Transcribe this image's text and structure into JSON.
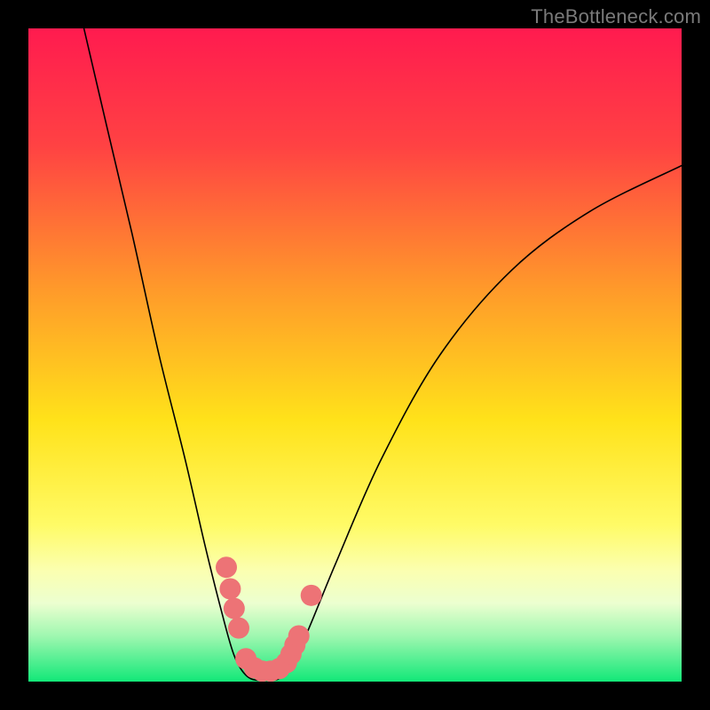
{
  "watermark": "TheBottleneck.com",
  "chart_data": {
    "type": "line",
    "title": "",
    "xlabel": "",
    "ylabel": "",
    "xlim": [
      0,
      100
    ],
    "ylim": [
      0,
      100
    ],
    "gradient_stops": [
      {
        "offset": 0,
        "color": "#ff1b4f"
      },
      {
        "offset": 18,
        "color": "#ff4243"
      },
      {
        "offset": 40,
        "color": "#ff9a2a"
      },
      {
        "offset": 60,
        "color": "#ffe21a"
      },
      {
        "offset": 76,
        "color": "#fffb66"
      },
      {
        "offset": 83,
        "color": "#fbffb0"
      },
      {
        "offset": 88,
        "color": "#ecffd0"
      },
      {
        "offset": 93,
        "color": "#9ff7b0"
      },
      {
        "offset": 100,
        "color": "#12e878"
      }
    ],
    "series": [
      {
        "name": "left-branch",
        "type": "curve",
        "points": [
          {
            "x": 8.5,
            "y": 100
          },
          {
            "x": 12,
            "y": 85
          },
          {
            "x": 16,
            "y": 68
          },
          {
            "x": 20,
            "y": 50
          },
          {
            "x": 24,
            "y": 34
          },
          {
            "x": 27,
            "y": 21
          },
          {
            "x": 29.5,
            "y": 11
          },
          {
            "x": 31.5,
            "y": 4
          },
          {
            "x": 33.5,
            "y": 0.8
          }
        ]
      },
      {
        "name": "valley-floor",
        "type": "curve",
        "points": [
          {
            "x": 33.5,
            "y": 0.8
          },
          {
            "x": 36,
            "y": 0.2
          },
          {
            "x": 39,
            "y": 0.9
          }
        ]
      },
      {
        "name": "right-branch",
        "type": "curve",
        "points": [
          {
            "x": 39,
            "y": 0.9
          },
          {
            "x": 42,
            "y": 6
          },
          {
            "x": 47,
            "y": 18
          },
          {
            "x": 54,
            "y": 34
          },
          {
            "x": 63,
            "y": 50
          },
          {
            "x": 74,
            "y": 63
          },
          {
            "x": 86,
            "y": 72
          },
          {
            "x": 100,
            "y": 79
          }
        ]
      }
    ],
    "markers": [
      {
        "x": 30.3,
        "y": 17.5
      },
      {
        "x": 30.9,
        "y": 14.2
      },
      {
        "x": 31.5,
        "y": 11.2
      },
      {
        "x": 32.2,
        "y": 8.2
      },
      {
        "x": 33.3,
        "y": 3.5
      },
      {
        "x": 34.6,
        "y": 2.1
      },
      {
        "x": 35.8,
        "y": 1.6
      },
      {
        "x": 37.1,
        "y": 1.6
      },
      {
        "x": 38.4,
        "y": 2.0
      },
      {
        "x": 39.5,
        "y": 2.9
      },
      {
        "x": 40.2,
        "y": 4.2
      },
      {
        "x": 40.8,
        "y": 5.6
      },
      {
        "x": 41.4,
        "y": 7.0
      },
      {
        "x": 43.3,
        "y": 13.2
      }
    ],
    "marker_style": {
      "radius": 12,
      "fill": "#ed7376",
      "stroke": "none"
    }
  }
}
